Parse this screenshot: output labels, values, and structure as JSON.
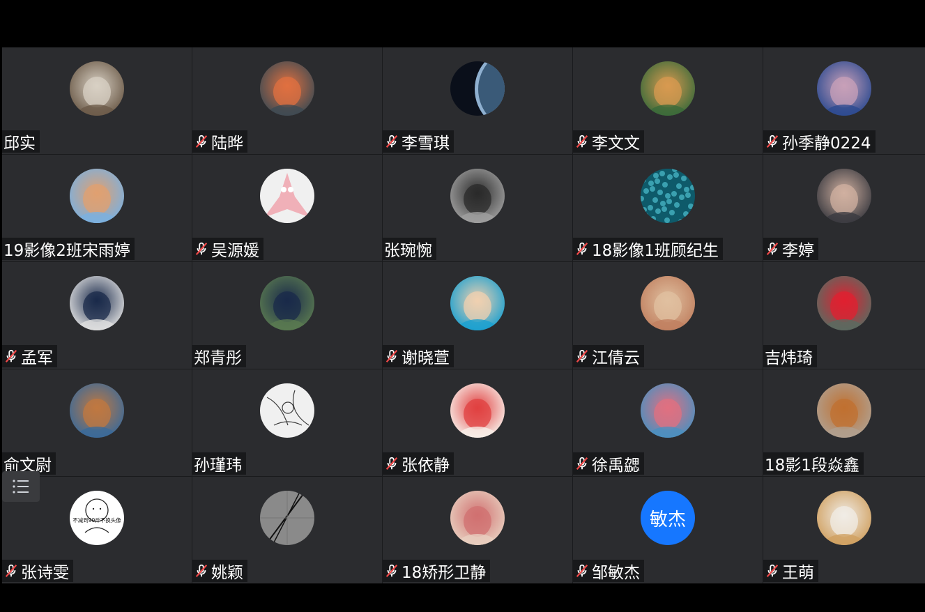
{
  "participants": [
    {
      "name": "邱实",
      "muted": false,
      "avatar": "cat-photo",
      "colors": [
        "#6b5a48",
        "#d8d0c4"
      ]
    },
    {
      "name": "陆晔",
      "muted": true,
      "avatar": "cartoon-girl",
      "colors": [
        "#3d4a52",
        "#e07040"
      ]
    },
    {
      "name": "李雪琪",
      "muted": true,
      "avatar": "earth-space",
      "colors": [
        "#0a0f1a",
        "#8fb0d0"
      ]
    },
    {
      "name": "李文文",
      "muted": true,
      "avatar": "shiba-dog",
      "colors": [
        "#3a6a3a",
        "#d89a50"
      ]
    },
    {
      "name": "孙季静0224",
      "muted": true,
      "avatar": "cartoon-room",
      "colors": [
        "#2c4a90",
        "#c8a0b8"
      ]
    },
    {
      "name": "19影像2班宋雨婷",
      "muted": false,
      "avatar": "cartoon-man",
      "colors": [
        "#7ab0e0",
        "#e0a070"
      ]
    },
    {
      "name": "吴源媛",
      "muted": true,
      "avatar": "patrick-star",
      "colors": [
        "#f0f0f0",
        "#f0b0b8"
      ]
    },
    {
      "name": "张琬惋",
      "muted": false,
      "avatar": "man-photo",
      "colors": [
        "#a0a0a0",
        "#2a2a2a"
      ]
    },
    {
      "name": "18影像1班顾纪生",
      "muted": true,
      "avatar": "teal-beads",
      "colors": [
        "#0e5a6a",
        "#3aa0b0"
      ]
    },
    {
      "name": "李婷",
      "muted": true,
      "avatar": "woman-photo",
      "colors": [
        "#3a3a40",
        "#d0b0a0"
      ]
    },
    {
      "name": "孟军",
      "muted": true,
      "avatar": "young-man-photo",
      "colors": [
        "#e0e0e0",
        "#1a2a4a"
      ]
    },
    {
      "name": "郑青彤",
      "muted": false,
      "avatar": "suit-man-photo",
      "colors": [
        "#5a7a50",
        "#1a2a4a"
      ]
    },
    {
      "name": "谢晓萱",
      "muted": true,
      "avatar": "cartoon-boy",
      "colors": [
        "#1aa0d0",
        "#f0d0b0"
      ]
    },
    {
      "name": "江倩云",
      "muted": true,
      "avatar": "fox-camera",
      "colors": [
        "#c08060",
        "#e0c0a0"
      ]
    },
    {
      "name": "吉炜琦",
      "muted": false,
      "avatar": "cat-glasses",
      "colors": [
        "#5a6a60",
        "#e02030"
      ]
    },
    {
      "name": "俞文尉",
      "muted": false,
      "avatar": "puppy-photo",
      "colors": [
        "#3a6a9a",
        "#c07840"
      ]
    },
    {
      "name": "孙瑾玮",
      "muted": false,
      "avatar": "sketch-art",
      "colors": [
        "#f0f0f0",
        "#3a3a3a"
      ]
    },
    {
      "name": "张依静",
      "muted": true,
      "avatar": "girl-watermelon",
      "colors": [
        "#f8f0ea",
        "#e04040"
      ]
    },
    {
      "name": "徐禹勰",
      "muted": true,
      "avatar": "woman-flowers",
      "colors": [
        "#4a90c0",
        "#e07080"
      ]
    },
    {
      "name": "18影1段焱鑫",
      "muted": false,
      "avatar": "shiba-selfie",
      "colors": [
        "#b0a090",
        "#c07030"
      ]
    },
    {
      "name": "张诗雯",
      "muted": true,
      "avatar": "meme-face",
      "colors": [
        "#ffffff",
        "#222222"
      ],
      "caption": "不减到90斤不换头像"
    },
    {
      "name": "姚颖",
      "muted": true,
      "avatar": "gray-lines",
      "colors": [
        "#8a8a8a",
        "#111111"
      ]
    },
    {
      "name": "18矫形卫静",
      "muted": true,
      "avatar": "cat-closeup",
      "colors": [
        "#e8d0c0",
        "#d07070"
      ]
    },
    {
      "name": "邹敏杰",
      "muted": true,
      "avatar": "text",
      "text": "敏杰",
      "colors": [
        "#1677ff",
        "#ffffff"
      ]
    },
    {
      "name": "王萌",
      "muted": true,
      "avatar": "ghost-figure",
      "colors": [
        "#d0a060",
        "#f0ece6"
      ]
    }
  ],
  "menu_icon": "list-icon",
  "mic_icon": "mic-muted-icon"
}
